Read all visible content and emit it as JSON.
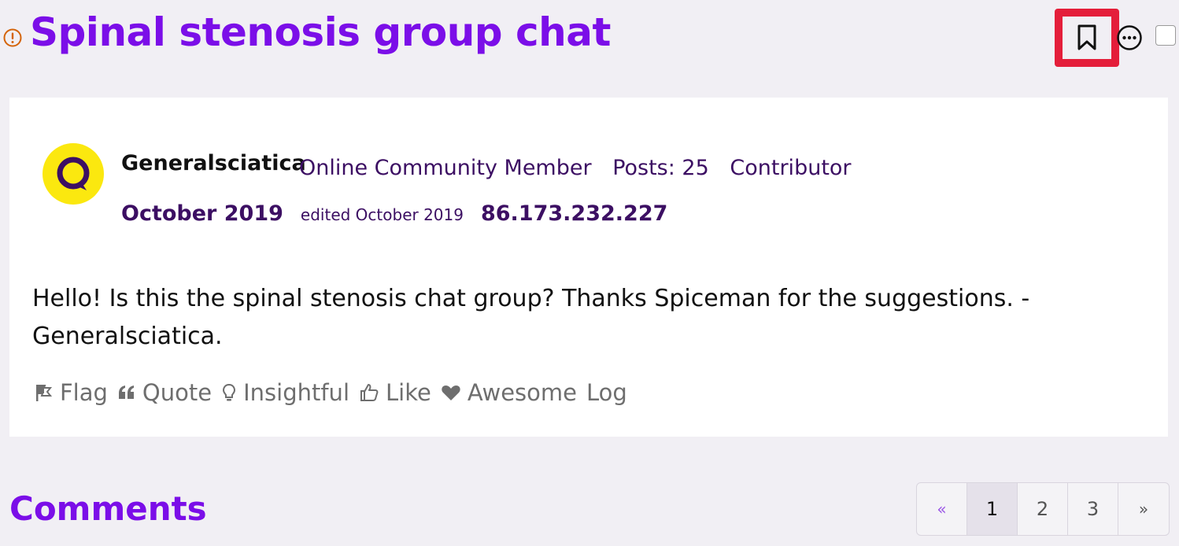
{
  "header": {
    "title": "Spinal stenosis group chat",
    "alert_icon": "exclamation-circle-icon",
    "bookmark_icon": "bookmark-icon",
    "more_icon": "ellipsis-circle-icon",
    "accent_color": "#7b0ee8",
    "highlight_color": "#e41e3a"
  },
  "post": {
    "author": "Generalsciatica",
    "avatar_icon": "speech-bubble-avatar-icon",
    "role": "Online Community Member",
    "posts": "Posts: 25",
    "rank": "Contributor",
    "date": "October 2019",
    "edited": "edited October 2019",
    "ip": "86.173.232.227",
    "body": "Hello! Is this the spinal stenosis chat group? Thanks Spiceman for the suggestions. - Generalsciatica.",
    "reactions": [
      {
        "label": "Flag",
        "icon": "flag-icon"
      },
      {
        "label": "Quote",
        "icon": "quote-icon"
      },
      {
        "label": "Insightful",
        "icon": "lightbulb-icon"
      },
      {
        "label": "Like",
        "icon": "thumbs-up-icon"
      },
      {
        "label": "Awesome",
        "icon": "heart-icon"
      },
      {
        "label": "Log",
        "icon": ""
      }
    ]
  },
  "comments": {
    "heading": "Comments",
    "pager": {
      "prev": "«",
      "pages": [
        "1",
        "2",
        "3"
      ],
      "current": "1",
      "next": "»"
    }
  }
}
